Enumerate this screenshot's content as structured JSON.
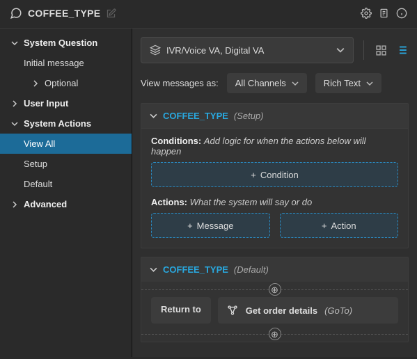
{
  "header": {
    "title": "COFFEE_TYPE"
  },
  "sidebar": {
    "system_question": "System Question",
    "initial_message": "Initial message",
    "optional": "Optional",
    "user_input": "User Input",
    "system_actions": "System Actions",
    "view_all": "View All",
    "setup": "Setup",
    "default": "Default",
    "advanced": "Advanced"
  },
  "channels": {
    "label": "IVR/Voice VA, Digital VA"
  },
  "filters": {
    "label": "View messages as:",
    "all_channels": "All Channels",
    "rich_text": "Rich Text"
  },
  "section_setup": {
    "title": "COFFEE_TYPE",
    "subtitle": "(Setup)",
    "conditions_label": "Conditions:",
    "conditions_hint": "Add logic for when the actions below will happen",
    "add_condition": "Condition",
    "actions_label": "Actions:",
    "actions_hint": "What the system will say or do",
    "add_message": "Message",
    "add_action": "Action"
  },
  "section_default": {
    "title": "COFFEE_TYPE",
    "subtitle": "(Default)",
    "return_to": "Return to",
    "goto_title": "Get order details",
    "goto_sub": "(GoTo)"
  }
}
